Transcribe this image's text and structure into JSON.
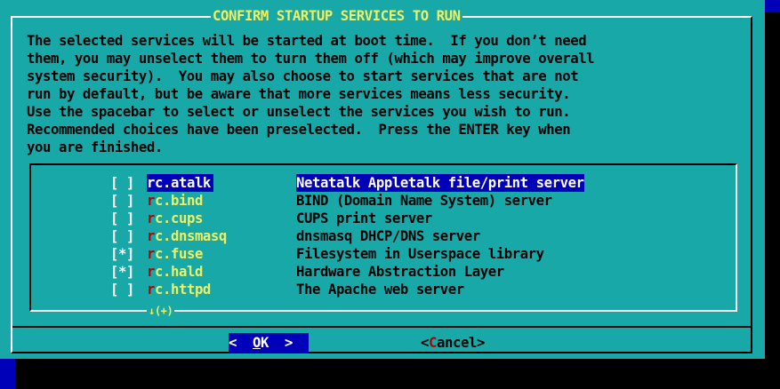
{
  "colors": {
    "screen_background": "#0000b8",
    "dialog_background": "#18a8a8",
    "title_text": "#f0f060",
    "body_text": "#000000",
    "highlight_background": "#0000b8",
    "highlight_text": "#ffffff",
    "hotkey": "#b80000",
    "checkbox_text": "#ffffff"
  },
  "dialog": {
    "title": "CONFIRM STARTUP SERVICES TO RUN",
    "description_lines": [
      "The selected services will be started at boot time.  If you don’t need",
      "them, you may unselect them to turn them off (which may improve overall",
      "system security).  You may also choose to start services that are not",
      "run by default, but be aware that more services means less security.",
      "Use the spacebar to select or unselect the services you wish to run.",
      "Recommended choices have been preselected.  Press the ENTER key when",
      "you are finished."
    ]
  },
  "services": [
    {
      "check": "[ ]",
      "hotkey": "r",
      "tag_rest": "c.atalk",
      "item": "Netatalk Appletalk file/print server",
      "selected": true
    },
    {
      "check": "[ ]",
      "hotkey": "r",
      "tag_rest": "c.bind",
      "item": "BIND (Domain Name System) server",
      "selected": false
    },
    {
      "check": "[ ]",
      "hotkey": "r",
      "tag_rest": "c.cups",
      "item": "CUPS print server",
      "selected": false
    },
    {
      "check": "[ ]",
      "hotkey": "r",
      "tag_rest": "c.dnsmasq",
      "item": "dnsmasq DHCP/DNS server",
      "selected": false
    },
    {
      "check": "[*]",
      "hotkey": "r",
      "tag_rest": "c.fuse",
      "item": "Filesystem in Userspace library",
      "selected": false
    },
    {
      "check": "[*]",
      "hotkey": "r",
      "tag_rest": "c.hald",
      "item": "Hardware Abstraction Layer",
      "selected": false
    },
    {
      "check": "[ ]",
      "hotkey": "r",
      "tag_rest": "c.httpd",
      "item": "The Apache web server",
      "selected": false
    }
  ],
  "scroll_indicator": "↓(+)",
  "buttons": {
    "ok": {
      "left": "<  ",
      "hotkey": "O",
      "rest": "K",
      "right": "  >"
    },
    "cancel": {
      "left": "<",
      "hotkey": "C",
      "rest": "ancel",
      "right": ">"
    }
  }
}
